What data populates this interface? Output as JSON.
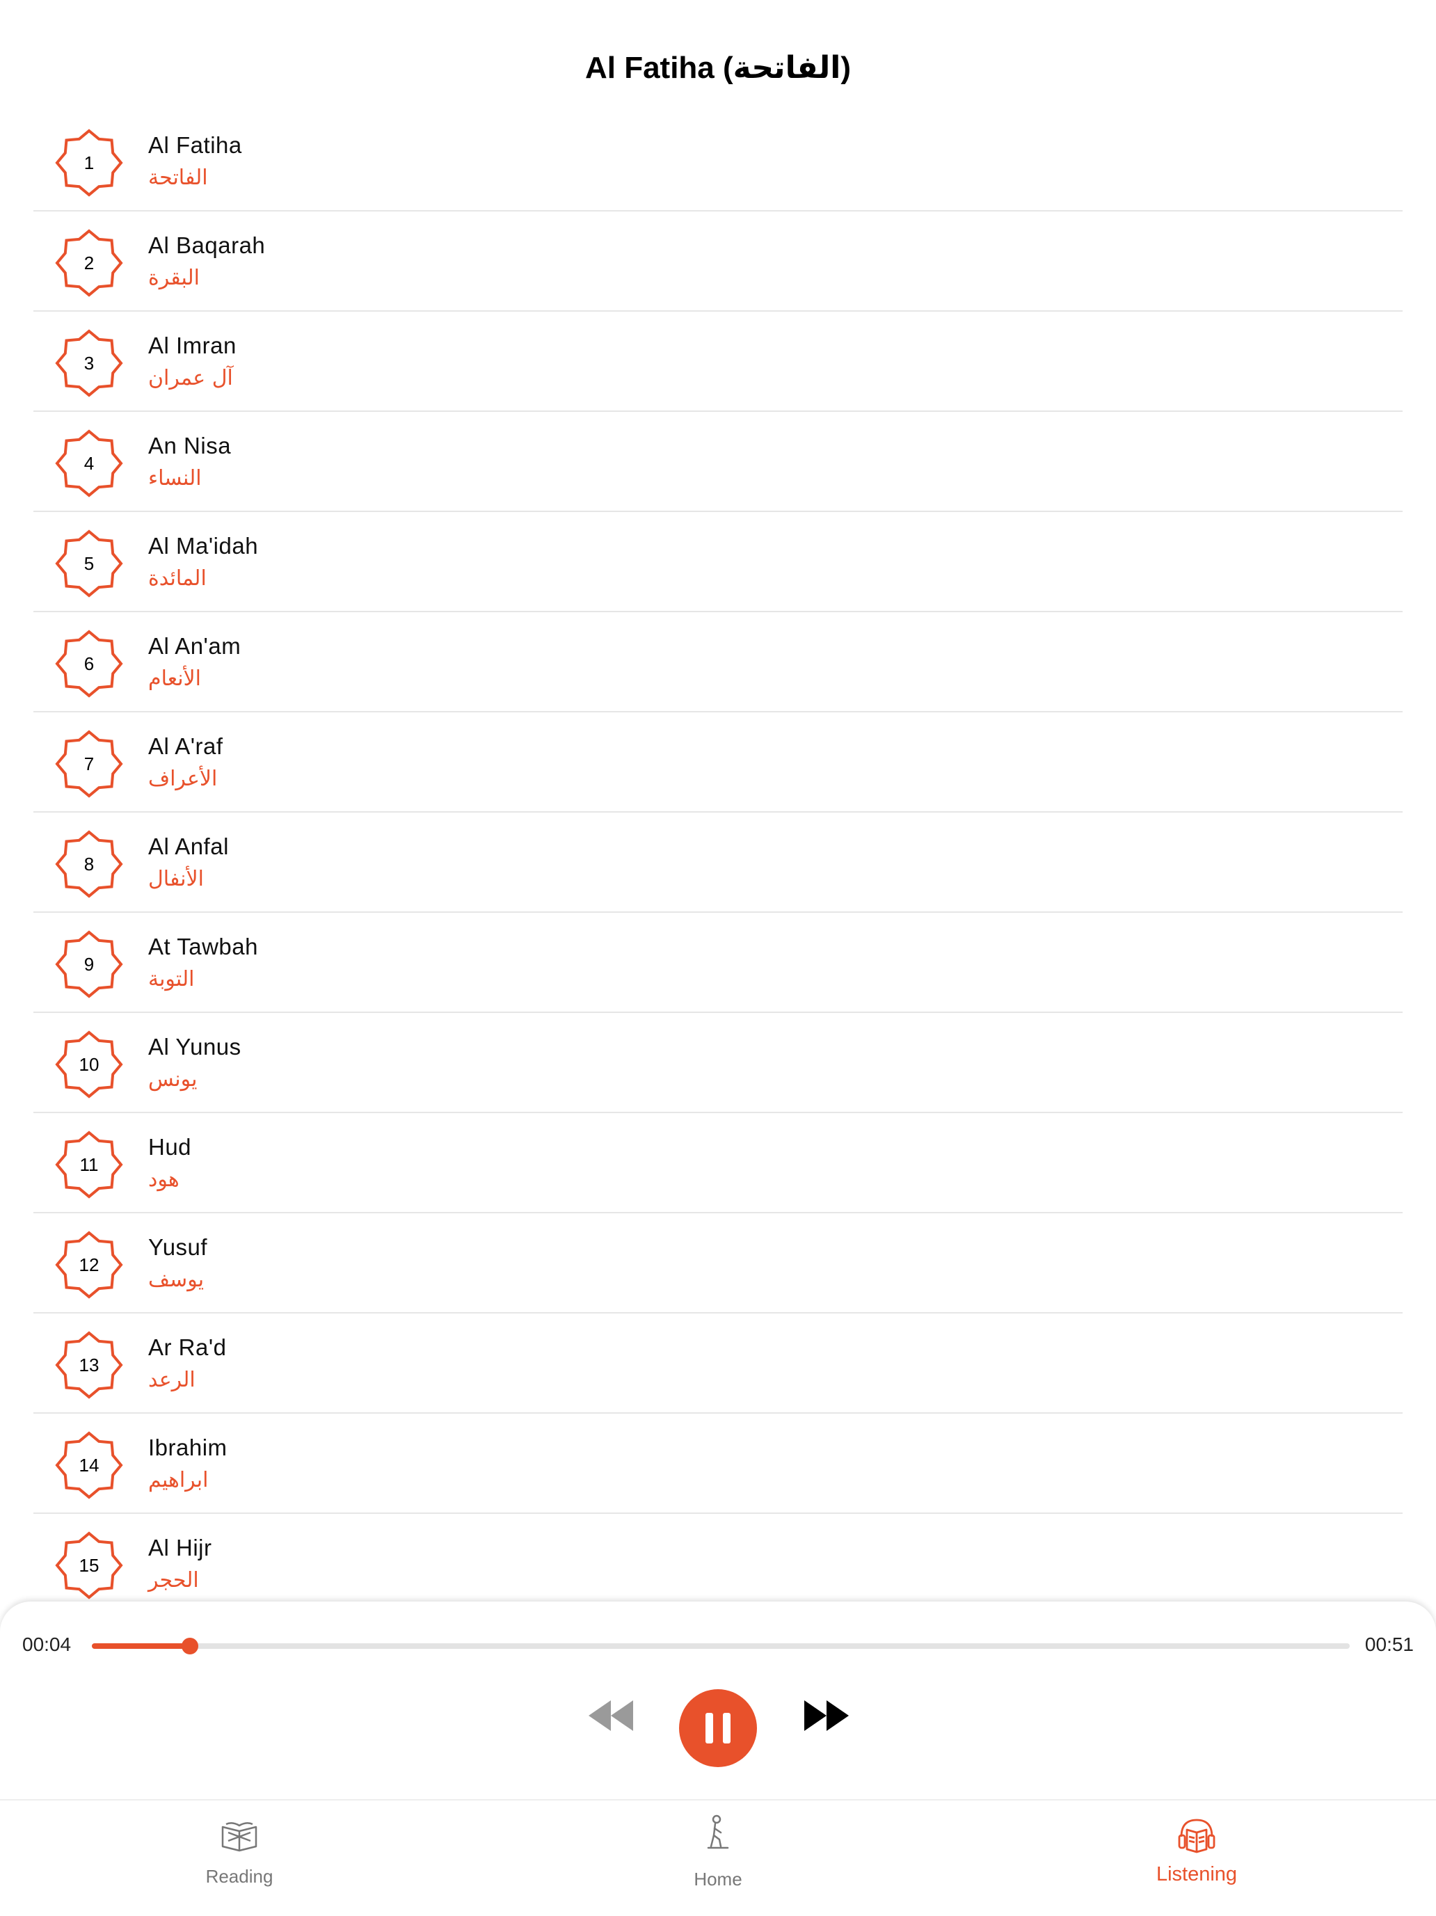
{
  "header": {
    "title": "Al Fatiha (الفاتحة)"
  },
  "surahs": [
    {
      "num": "1",
      "en": "Al Fatiha",
      "ar": "الفاتحة"
    },
    {
      "num": "2",
      "en": "Al Baqarah",
      "ar": "البقرة"
    },
    {
      "num": "3",
      "en": "Al Imran",
      "ar": "آل عمران"
    },
    {
      "num": "4",
      "en": "An Nisa",
      "ar": "النساء"
    },
    {
      "num": "5",
      "en": "Al Ma'idah",
      "ar": "المائدة"
    },
    {
      "num": "6",
      "en": "Al An'am",
      "ar": "الأنعام"
    },
    {
      "num": "7",
      "en": "Al A'raf",
      "ar": "الأعراف"
    },
    {
      "num": "8",
      "en": "Al Anfal",
      "ar": "الأنفال"
    },
    {
      "num": "9",
      "en": "At Tawbah",
      "ar": "التوبة"
    },
    {
      "num": "10",
      "en": "Al Yunus",
      "ar": "يونس"
    },
    {
      "num": "11",
      "en": "Hud",
      "ar": "هود"
    },
    {
      "num": "12",
      "en": "Yusuf",
      "ar": "يوسف"
    },
    {
      "num": "13",
      "en": "Ar Ra'd",
      "ar": "الرعد"
    },
    {
      "num": "14",
      "en": "Ibrahim",
      "ar": "ابراهيم"
    },
    {
      "num": "15",
      "en": "Al Hijr",
      "ar": "الحجر"
    }
  ],
  "player": {
    "current_time": "00:04",
    "total_time": "00:51",
    "progress_fraction": 0.078,
    "rewind_icon": "rewind-icon",
    "play_pause_icon": "pause-icon",
    "forward_icon": "fast-forward-icon"
  },
  "tabs": [
    {
      "label": "Reading",
      "icon": "book-icon",
      "active": false
    },
    {
      "label": "Home",
      "icon": "praying-person-icon",
      "active": false
    },
    {
      "label": "Listening",
      "icon": "headphones-book-icon",
      "active": true
    }
  ],
  "colors": {
    "accent": "#E8512B",
    "inactive_tab": "#777777",
    "divider": "#e6e6e6"
  }
}
